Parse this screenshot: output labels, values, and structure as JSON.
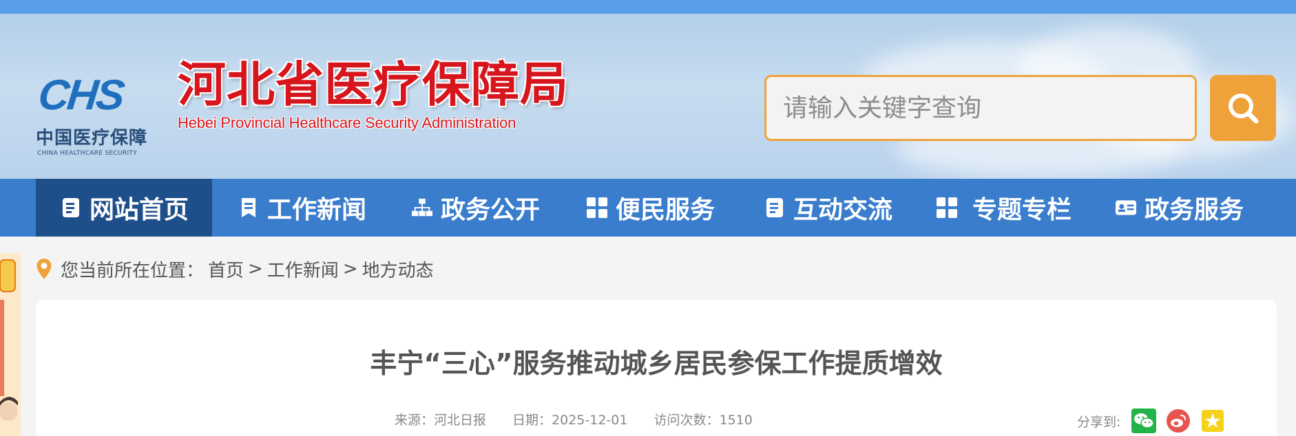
{
  "logo": {
    "mark": "CHS",
    "cn": "中国医疗保障",
    "en": "CHINA HEALTHCARE SECURITY"
  },
  "site": {
    "title_cn": "河北省医疗保障局",
    "title_en": "Hebei Provincial Healthcare Security Administration"
  },
  "search": {
    "placeholder": "请输入关键字查询",
    "button_icon": "search-icon"
  },
  "nav": {
    "items": [
      {
        "label": "网站首页",
        "icon": "document-icon",
        "active": true
      },
      {
        "label": "工作新闻",
        "icon": "bookmark-icon",
        "active": false
      },
      {
        "label": "政务公开",
        "icon": "sitemap-icon",
        "active": false
      },
      {
        "label": "便民服务",
        "icon": "grid-icon",
        "active": false
      },
      {
        "label": "互动交流",
        "icon": "document-icon",
        "active": false
      },
      {
        "label": "专题专栏",
        "icon": "grid-icon",
        "active": false
      },
      {
        "label": "政务服务",
        "icon": "id-card-icon",
        "active": false
      }
    ]
  },
  "breadcrumb": {
    "icon": "location-pin-icon",
    "prefix": "您当前所在位置：",
    "items": [
      "首页",
      "工作新闻",
      "地方动态"
    ],
    "separator": ">"
  },
  "article": {
    "title": "丰宁“三心”服务推动城乡居民参保工作提质增效",
    "source_label": "来源：",
    "source": "河北日报",
    "date_label": "日期：",
    "date": "2025-12-01",
    "visits_label": "访问次数：",
    "visits": "1510"
  },
  "share": {
    "label": "分享到:",
    "buttons": [
      "wechat-icon",
      "weibo-icon",
      "qzone-icon"
    ]
  },
  "colors": {
    "topbar": "#5a9ee8",
    "nav": "#3a7dcd",
    "nav_active": "#1f4f8a",
    "accent": "#f0a23a",
    "title_red": "#d7151c"
  }
}
